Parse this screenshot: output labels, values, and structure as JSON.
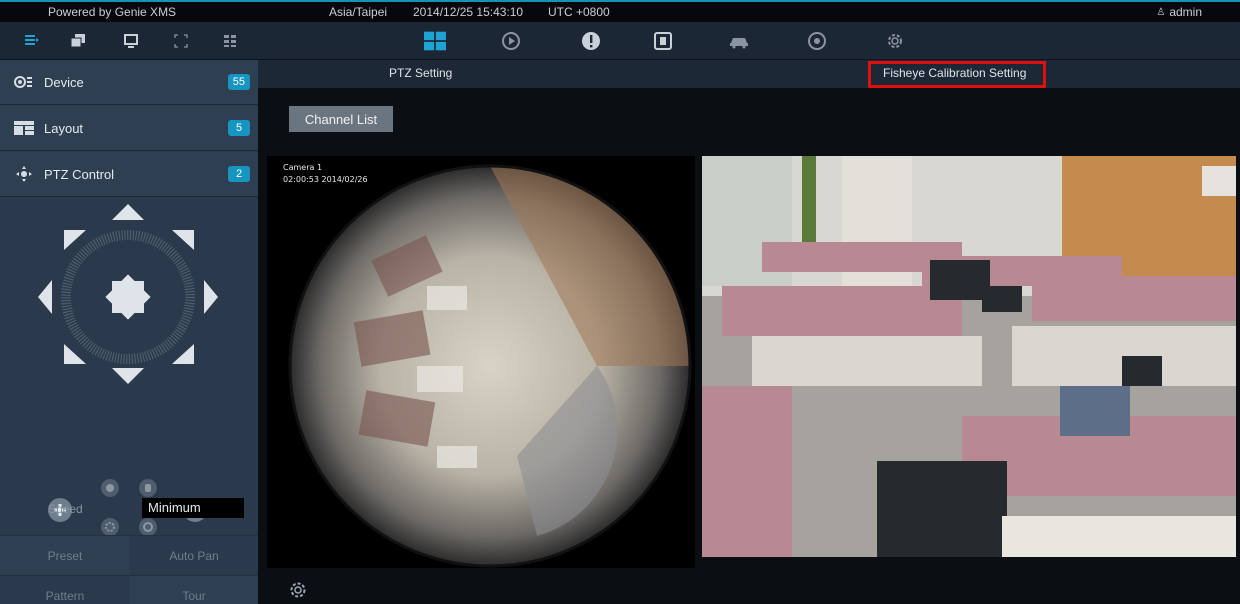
{
  "statusbar": {
    "brand": "Powered by Genie XMS",
    "timezone": "Asia/Taipei",
    "datetime": "2014/12/25 15:43:10",
    "utc": "UTC +0800",
    "user": "admin"
  },
  "toolbar": {
    "left_icons": [
      "live-view-icon",
      "window-icon",
      "monitor-icon",
      "fullscreen-icon",
      "grid-icon"
    ],
    "center_icons": [
      "layout-grid-icon",
      "playback-icon",
      "alert-icon",
      "keypad-icon",
      "vehicle-icon",
      "ptz-icon",
      "settings-icon"
    ]
  },
  "sidebar": {
    "device": {
      "label": "Device",
      "count": "55"
    },
    "layout": {
      "label": "Layout",
      "count": "5"
    },
    "ptz": {
      "label": "PTZ Control",
      "count": "2"
    },
    "speed_label": "Speed",
    "speed_value": "Minimum",
    "buttons": {
      "preset": "Preset",
      "auto_pan": "Auto Pan",
      "pattern": "Pattern",
      "tour": "Tour"
    }
  },
  "main": {
    "tabs": {
      "ptz": "PTZ Setting",
      "fisheye": "Fisheye Calibration Setting"
    },
    "channel_list": "Channel List",
    "camera": {
      "name": "Camera 1",
      "timestamp": "02:00:53  2014/02/26"
    }
  },
  "colors": {
    "accent": "#1795c0",
    "highlight": "#e01010",
    "sidebar": "#2b3a4c"
  }
}
